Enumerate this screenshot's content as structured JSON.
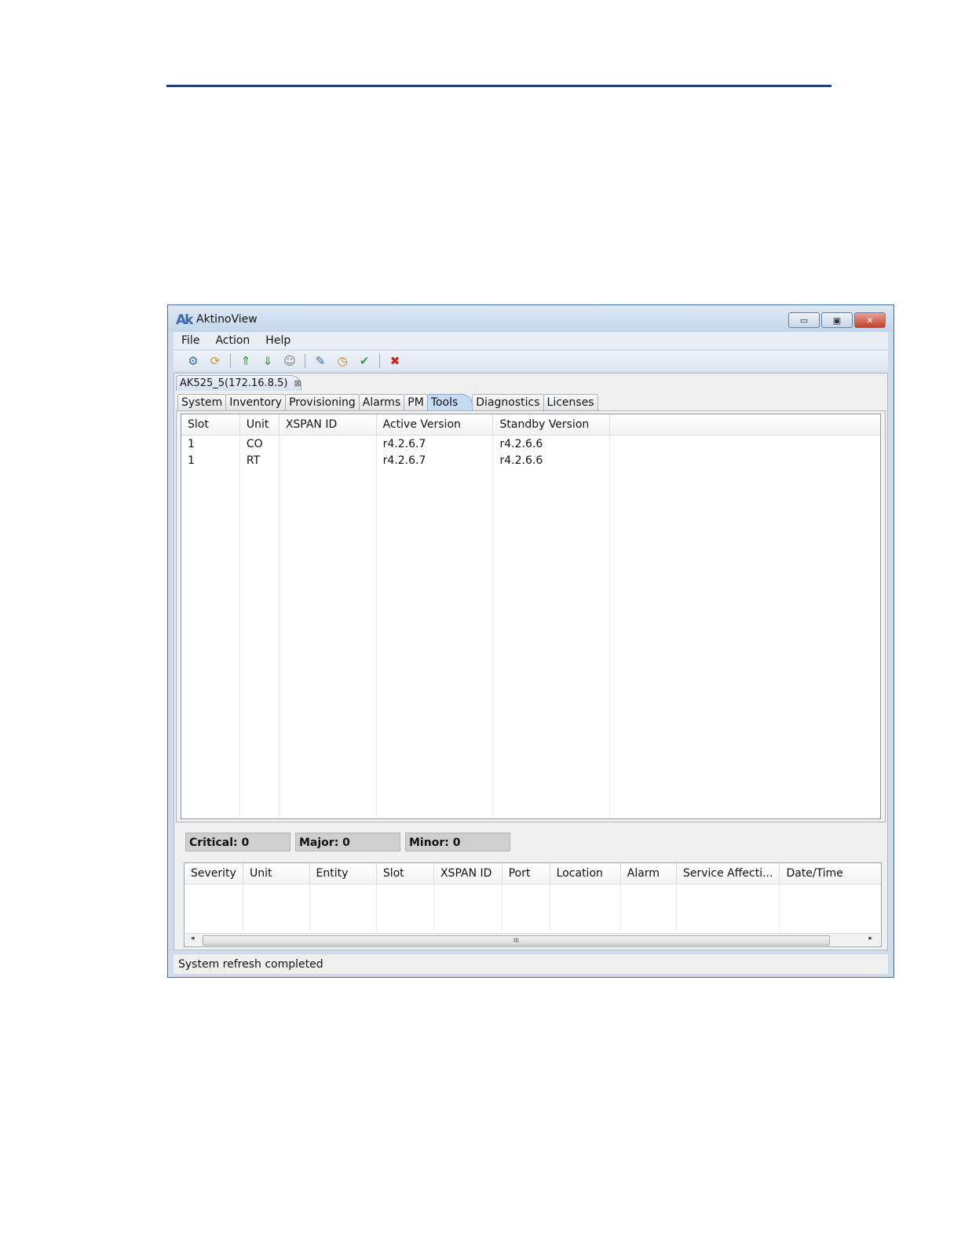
{
  "window": {
    "logo": "Ak",
    "title": "AktinoView",
    "controls": {
      "minimize": "▭",
      "maximize": "▣",
      "close": "✕"
    }
  },
  "menu": [
    "File",
    "Action",
    "Help"
  ],
  "toolbar": {
    "icons": [
      {
        "name": "connect-icon",
        "glyph": "⚙"
      },
      {
        "name": "refresh-icon",
        "glyph": "⟳"
      },
      {
        "name": "upload-icon",
        "glyph": "⇑"
      },
      {
        "name": "download-icon",
        "glyph": "⇓"
      },
      {
        "name": "user-icon",
        "glyph": "☺"
      },
      {
        "name": "config-icon",
        "glyph": "✎"
      },
      {
        "name": "clock-icon",
        "glyph": "◷"
      },
      {
        "name": "check-icon",
        "glyph": "✔"
      },
      {
        "name": "stop-icon",
        "glyph": "✖"
      }
    ]
  },
  "document_tab": {
    "label": "AK525_5(172.16.8.5)",
    "close": "⊠"
  },
  "tabs": [
    "System",
    "Inventory",
    "Provisioning",
    "Alarms",
    "PM",
    "Tools",
    "Diagnostics",
    "Licenses"
  ],
  "active_tab": "Tools",
  "versions_table": {
    "headers": [
      "Slot",
      "Unit",
      "XSPAN ID",
      "Active Version",
      "Standby Version"
    ],
    "rows": [
      [
        "1",
        "CO",
        "",
        "r4.2.6.7",
        "r4.2.6.6"
      ],
      [
        "1",
        "RT",
        "",
        "r4.2.6.7",
        "r4.2.6.6"
      ]
    ]
  },
  "alarm_counts": {
    "critical": "Critical: 0",
    "major": "Major: 0",
    "minor": "Minor: 0"
  },
  "alarms_table": {
    "headers": [
      "Severity",
      "Unit",
      "Entity",
      "Slot",
      "XSPAN ID",
      "Port",
      "Location",
      "Alarm",
      "Service Affecti...",
      "Date/Time"
    ]
  },
  "scrollbar": {
    "left": "◂",
    "right": "▸",
    "grip": "III"
  },
  "status": "System refresh completed"
}
